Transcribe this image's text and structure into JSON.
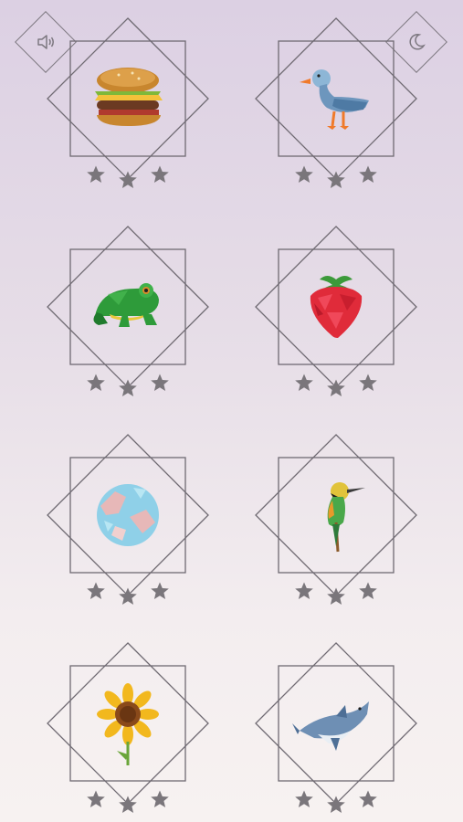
{
  "toolbar": {
    "sound_icon": "speaker-icon",
    "night_icon": "moon-icon"
  },
  "colors": {
    "frame": "#6f6a72",
    "star": "#7a767b"
  },
  "levels": [
    {
      "name": "burger",
      "icon": "burger-icon",
      "stars_earned": 0,
      "stars_total": 3
    },
    {
      "name": "duck",
      "icon": "duck-icon",
      "stars_earned": 0,
      "stars_total": 3
    },
    {
      "name": "frog",
      "icon": "frog-icon",
      "stars_earned": 0,
      "stars_total": 3
    },
    {
      "name": "strawberry",
      "icon": "strawberry-icon",
      "stars_earned": 0,
      "stars_total": 3
    },
    {
      "name": "planet",
      "icon": "planet-icon",
      "stars_earned": 0,
      "stars_total": 3
    },
    {
      "name": "bird",
      "icon": "bird-icon",
      "stars_earned": 0,
      "stars_total": 3
    },
    {
      "name": "sunflower",
      "icon": "sunflower-icon",
      "stars_earned": 0,
      "stars_total": 3
    },
    {
      "name": "shark",
      "icon": "shark-icon",
      "stars_earned": 0,
      "stars_total": 3
    }
  ]
}
